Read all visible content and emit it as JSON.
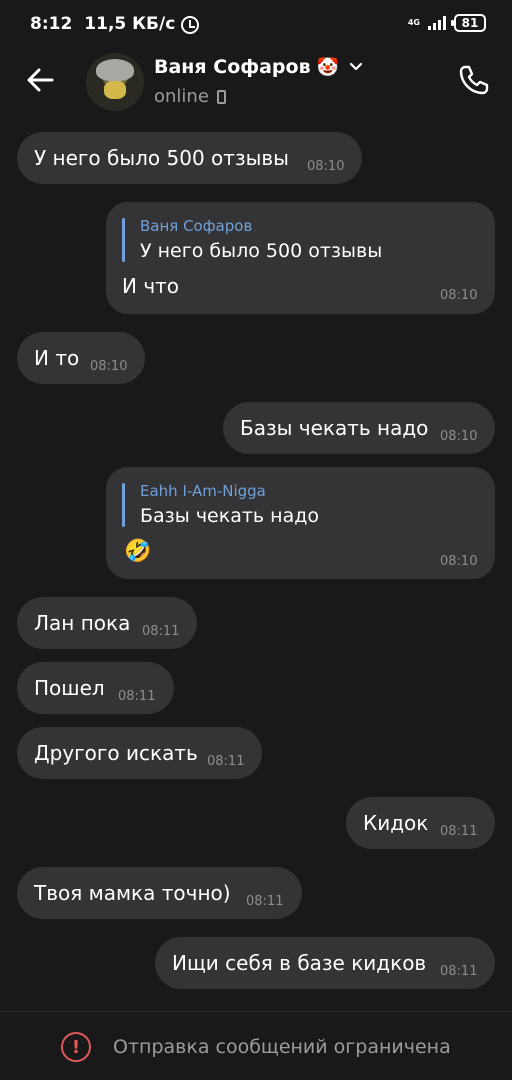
{
  "status_bar": {
    "time": "8:12",
    "speed": "11,5 КБ/с",
    "network": "4G",
    "battery": "81"
  },
  "header": {
    "name": "Ваня Софаров",
    "name_emoji": "🤡",
    "status": "online"
  },
  "messages": [
    {
      "side": "in",
      "text": "У него было 500 отзывы",
      "time": "08:10"
    },
    {
      "side": "out",
      "reply_to": {
        "name": "Ваня Софаров",
        "text": "У него было 500 отзывы"
      },
      "text": "И что",
      "time": "08:10"
    },
    {
      "side": "in",
      "text": "И то",
      "time": "08:10"
    },
    {
      "side": "out",
      "text": "Базы чекать надо",
      "time": "08:10"
    },
    {
      "side": "out",
      "reply_to": {
        "name": "Eahh I-Am-Nigga",
        "text": "Базы чекать надо"
      },
      "text": "🤣",
      "time": "08:10"
    },
    {
      "side": "in",
      "text": "Лан пока",
      "time": "08:11"
    },
    {
      "side": "in",
      "text": "Пошел",
      "time": "08:11"
    },
    {
      "side": "in",
      "text": "Другого искать",
      "time": "08:11"
    },
    {
      "side": "out",
      "text": "Кидок",
      "time": "08:11"
    },
    {
      "side": "in",
      "text": "Твоя мамка точно)",
      "time": "08:11"
    },
    {
      "side": "out",
      "text": "Ищи себя в базе кидков",
      "time": "08:11"
    }
  ],
  "footer": {
    "text": "Отправка сообщений ограничена"
  }
}
